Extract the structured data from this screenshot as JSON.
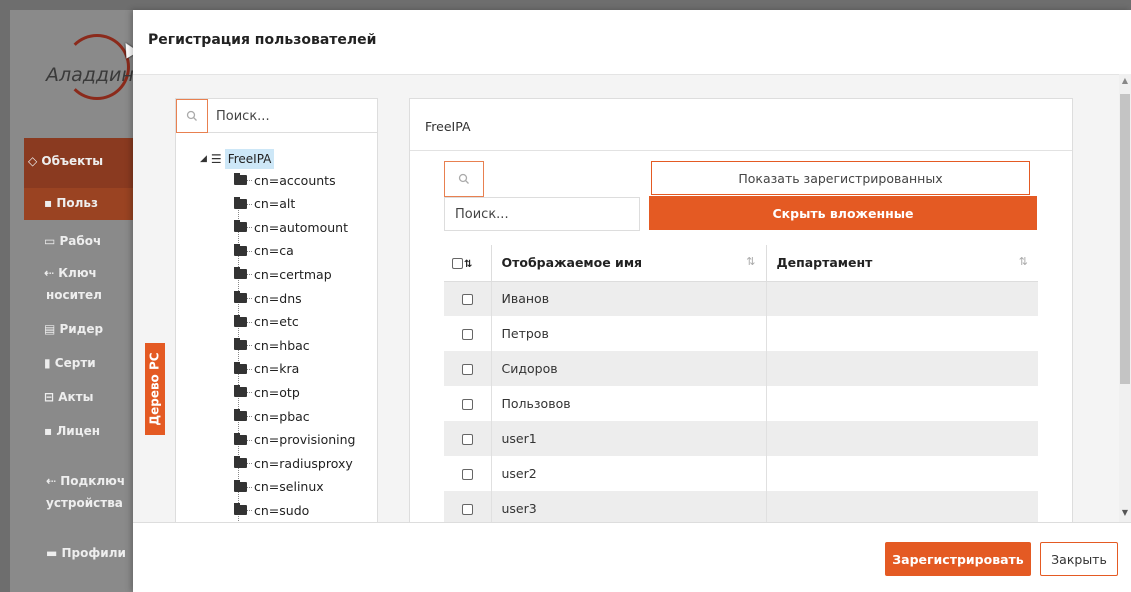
{
  "background": {
    "logo_text": "Аладдин",
    "nav": [
      {
        "label": "Объекты",
        "icon": "diamond-icon"
      },
      {
        "label": "Польз",
        "icon": "users-icon"
      },
      {
        "label": "Рабоч",
        "icon": "monitor-icon"
      },
      {
        "label": "Ключ",
        "icon": "usb-icon"
      },
      {
        "label": "носител",
        "icon": ""
      },
      {
        "label": "Ридер",
        "icon": "card-reader-icon"
      },
      {
        "label": "Серти",
        "icon": "file-icon"
      },
      {
        "label": "Акты",
        "icon": "print-icon"
      },
      {
        "label": "Лицен",
        "icon": "users-icon"
      },
      {
        "label": "Подключ",
        "icon": "usb-icon"
      },
      {
        "label": "устройства",
        "icon": ""
      },
      {
        "label": "Профили",
        "icon": "folder-icon"
      }
    ]
  },
  "dialog": {
    "title": "Регистрация пользователей",
    "tree_tab_label": "Дерево PC",
    "tree": {
      "search_placeholder": "Поиск...",
      "root": "FreeIPA",
      "nodes": [
        "cn=accounts",
        "cn=alt",
        "cn=automount",
        "cn=ca",
        "cn=certmap",
        "cn=dns",
        "cn=etc",
        "cn=hbac",
        "cn=kra",
        "cn=otp",
        "cn=pbac",
        "cn=provisioning",
        "cn=radiusproxy",
        "cn=selinux",
        "cn=sudo"
      ]
    },
    "main": {
      "header": "FreeIPA",
      "search_placeholder": "Поиск...",
      "show_registered_label": "Показать зарегистрированных",
      "hide_nested_label": "Скрыть вложенные",
      "columns": [
        "Отображаемое имя",
        "Департамент"
      ],
      "rows": [
        {
          "name": "Иванов",
          "department": ""
        },
        {
          "name": "Петров",
          "department": ""
        },
        {
          "name": "Сидоров",
          "department": ""
        },
        {
          "name": "Пользовов",
          "department": ""
        },
        {
          "name": "user1",
          "department": ""
        },
        {
          "name": "user2",
          "department": ""
        },
        {
          "name": "user3",
          "department": ""
        }
      ]
    },
    "footer": {
      "register_label": "Зарегистрировать",
      "close_label": "Закрыть"
    }
  },
  "colors": {
    "accent": "#e45a23",
    "tree_selected": "#cde7f7"
  }
}
